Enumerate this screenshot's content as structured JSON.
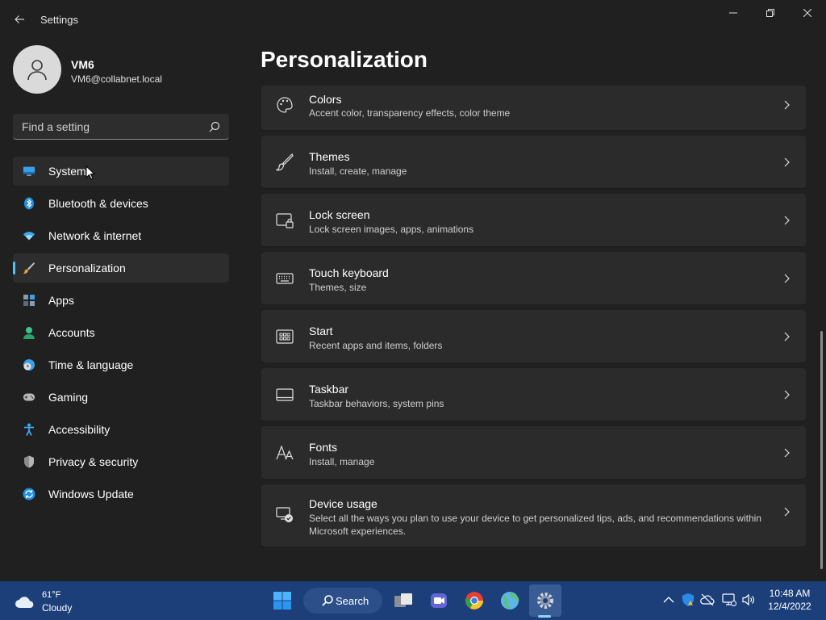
{
  "window": {
    "app_title": "Settings"
  },
  "profile": {
    "name": "VM6",
    "email": "VM6@collabnet.local"
  },
  "search": {
    "placeholder": "Find a setting"
  },
  "nav": {
    "items": [
      {
        "label": "System",
        "icon": "system-icon"
      },
      {
        "label": "Bluetooth & devices",
        "icon": "bluetooth-icon"
      },
      {
        "label": "Network & internet",
        "icon": "wifi-icon"
      },
      {
        "label": "Personalization",
        "icon": "brush-icon",
        "active": true
      },
      {
        "label": "Apps",
        "icon": "apps-icon"
      },
      {
        "label": "Accounts",
        "icon": "accounts-icon"
      },
      {
        "label": "Time & language",
        "icon": "clock-globe-icon"
      },
      {
        "label": "Gaming",
        "icon": "gamepad-icon"
      },
      {
        "label": "Accessibility",
        "icon": "accessibility-icon"
      },
      {
        "label": "Privacy & security",
        "icon": "shield-icon"
      },
      {
        "label": "Windows Update",
        "icon": "update-icon"
      }
    ]
  },
  "main": {
    "title": "Personalization",
    "cards": [
      {
        "title": "Colors",
        "desc": "Accent color, transparency effects, color theme",
        "icon": "palette-icon"
      },
      {
        "title": "Themes",
        "desc": "Install, create, manage",
        "icon": "brush-icon"
      },
      {
        "title": "Lock screen",
        "desc": "Lock screen images, apps, animations",
        "icon": "lock-screen-icon"
      },
      {
        "title": "Touch keyboard",
        "desc": "Themes, size",
        "icon": "keyboard-icon"
      },
      {
        "title": "Start",
        "desc": "Recent apps and items, folders",
        "icon": "start-icon"
      },
      {
        "title": "Taskbar",
        "desc": "Taskbar behaviors, system pins",
        "icon": "taskbar-icon"
      },
      {
        "title": "Fonts",
        "desc": "Install, manage",
        "icon": "fonts-icon"
      },
      {
        "title": "Device usage",
        "desc": "Select all the ways you plan to use your device to get personalized tips, ads, and recommendations within Microsoft experiences.",
        "icon": "device-usage-icon"
      }
    ]
  },
  "taskbar": {
    "weather_temp": "61°F",
    "weather_condition": "Cloudy",
    "search_label": "Search",
    "time": "10:48 AM",
    "date": "12/4/2022"
  },
  "colors": {
    "accent": "#4cc2ff",
    "background": "#202020",
    "card": "#2b2b2b",
    "taskbar": "#1c3f7a"
  }
}
